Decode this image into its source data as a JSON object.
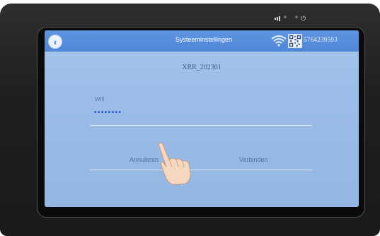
{
  "header": {
    "title": "Systeeminstellingen",
    "serial": "5764239593"
  },
  "main": {
    "device_name": "XRR_202301",
    "wifi_label": "Wifi",
    "wifi_value": "••••••••"
  },
  "actions": {
    "cancel_label": "Annuleren",
    "connect_label": "Verbinden"
  },
  "colors": {
    "titlebar": "#4f87d8",
    "screen": "#9bbde7",
    "input_text": "#2f63d2"
  },
  "icons": [
    "back-icon",
    "wifi-icon",
    "qr-code-icon",
    "pointing-hand-icon",
    "power-icon"
  ]
}
